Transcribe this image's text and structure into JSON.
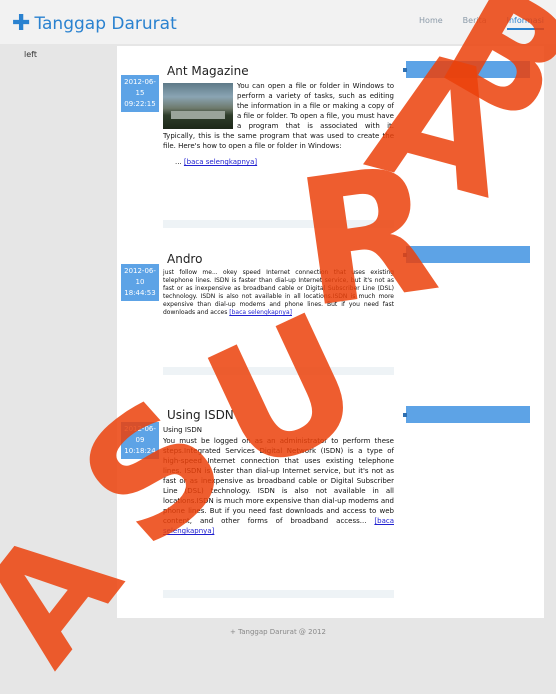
{
  "header": {
    "brand": "Tanggap Darurat",
    "nav": [
      {
        "label": "Home",
        "active": false
      },
      {
        "label": "Berita",
        "active": false
      },
      {
        "label": "Informasi",
        "active": true
      }
    ]
  },
  "left_label": "left",
  "posts": [
    {
      "date": "2012-06-15",
      "time": "09:22:15",
      "title": "Ant Magazine",
      "body": "You can open a file or folder in Windows to perform a variety of tasks, such as editing the information in a file or making a copy of a file or folder. To open a file, you must have a program that is associated with it. Typically, this is the same program that was used to create the file. Here's how to open a file or folder in Windows:",
      "ellipsis": "...",
      "readmore": "[baca selengkapnya]"
    },
    {
      "date": "2012-06-10",
      "time": "18:44:53",
      "title": "Andro",
      "body": "just follow me... okey speed Internet connection that uses existing telephone lines. ISDN is faster than dial-up Internet service, but it's not as fast or as inexpensive as broadband cable or Digital Subscriber Line (DSL) technology. ISDN is also not available in all locations.ISDN is much more expensive than dial-up modems and phone lines. But if you need fast downloads and acces",
      "readmore": "[baca selengkapnya]"
    },
    {
      "date": "2012-06-09",
      "time": "10:18:24",
      "title": "Using ISDN",
      "subtitle": "Using ISDN",
      "body": "You must be logged on as an administrator to perform these steps.Integrated Services Digital Network (ISDN) is a type of high-speed Internet connection that uses existing telephone lines. ISDN is faster than dial-up Internet service, but it's not as fast or as inexpensive as broadband cable or Digital Subscriber Line (DSL) technology. ISDN is also not available in all locations.ISDN is much more expensive than dial-up modems and phone lines. But if you need fast downloads and access to web content, and other forms of broadband access...",
      "readmore": "[baca selengkapnya]"
    }
  ],
  "footer": "+ Tanggap Darurat @ 2012",
  "watermark": "A S U R A B",
  "colors": {
    "accent": "#2a82d0",
    "date_bg": "#5da3e6",
    "watermark": "#eb410a"
  }
}
